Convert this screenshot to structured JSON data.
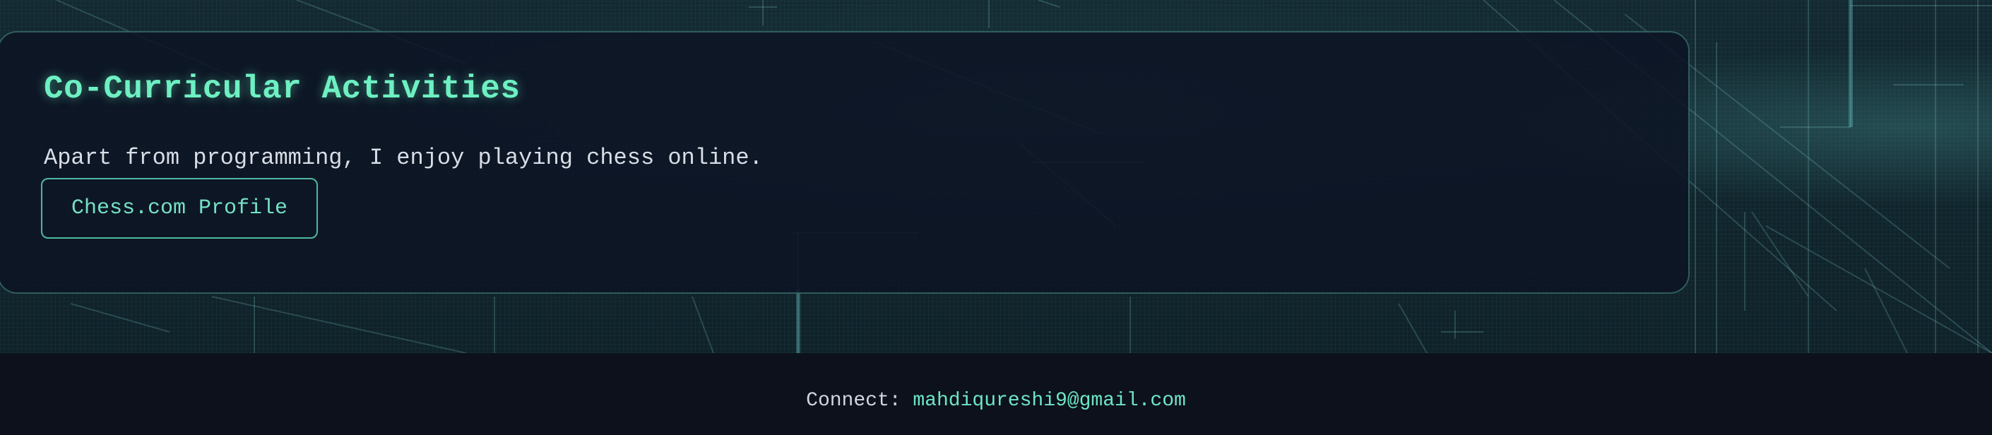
{
  "section": {
    "title": "Co-Curricular Activities",
    "description": "Apart from programming, I enjoy playing chess online.",
    "button_label": "Chess.com Profile"
  },
  "footer": {
    "connect_label": "Connect:",
    "email": "mahdiqureshi9@gmail.com"
  },
  "colors": {
    "accent": "#6ef0c2",
    "card_background": "#0d1424",
    "page_background": "#0c111b",
    "body_text": "#d8dde6"
  }
}
